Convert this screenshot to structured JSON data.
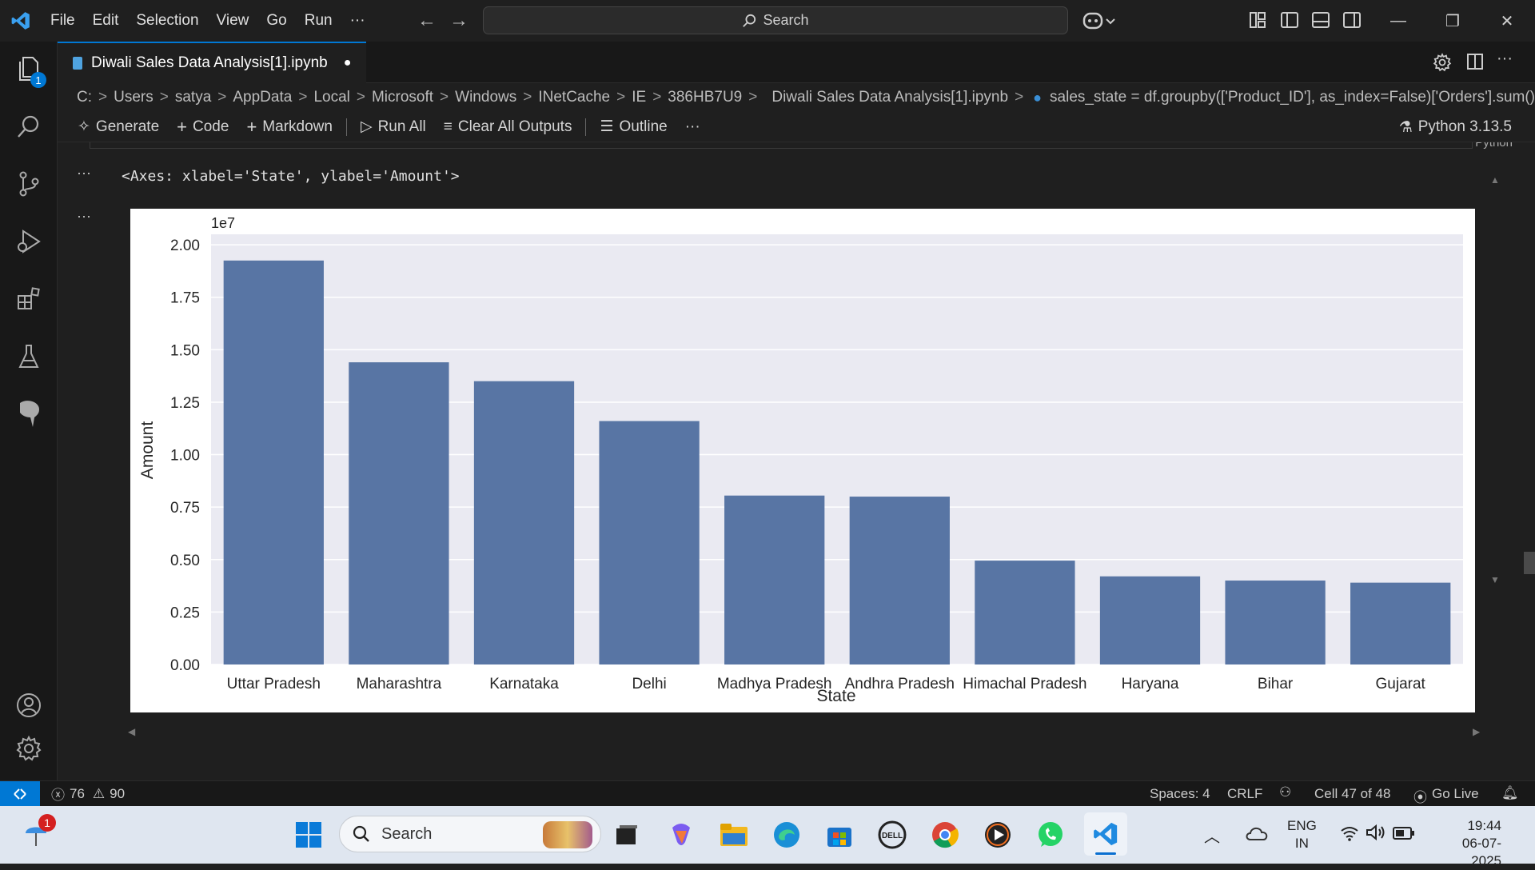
{
  "menu": [
    "File",
    "Edit",
    "Selection",
    "View",
    "Go",
    "Run",
    "···"
  ],
  "search": {
    "label": "Search"
  },
  "tab": {
    "title": "Diwali Sales Data Analysis[1].ipynb"
  },
  "explorer_badge": "1",
  "breadcrumb": [
    "C:",
    "Users",
    "satya",
    "AppData",
    "Local",
    "Microsoft",
    "Windows",
    "INetCache",
    "IE",
    "386HB7U9",
    "Diwali Sales Data Analysis[1].ipynb",
    "sales_state = df.groupby(['Product_ID'], as_index=False)['Orders'].sum()."
  ],
  "toolbar": {
    "generate": "Generate",
    "code": "Code",
    "markdown": "Markdown",
    "run_all": "Run All",
    "clear_outputs": "Clear All Outputs",
    "outline": "Outline",
    "more": "···",
    "kernel": "Python 3.13.5"
  },
  "cell": {
    "partial_label": "Python",
    "output_text": "<Axes: xlabel='State', ylabel='Amount'>",
    "ellipsis": "···"
  },
  "chart_data": {
    "type": "bar",
    "categories": [
      "Uttar Pradesh",
      "Maharashtra",
      "Karnataka",
      "Delhi",
      "Madhya Pradesh",
      "Andhra Pradesh",
      "Himachal Pradesh",
      "Haryana",
      "Bihar",
      "Gujarat"
    ],
    "values": [
      19.25,
      14.4,
      13.5,
      11.6,
      8.05,
      8.0,
      4.95,
      4.2,
      4.0,
      3.9
    ],
    "multiplier": "1e7",
    "xlabel": "State",
    "ylabel": "Amount",
    "yticks": [
      "0.00",
      "0.25",
      "0.50",
      "0.75",
      "1.00",
      "1.25",
      "1.50",
      "1.75",
      "2.00"
    ],
    "ylim": [
      0,
      20.5
    ],
    "bar_color": "#5875a4",
    "background": "#eaeaf2",
    "grid": true
  },
  "status": {
    "errors": "76",
    "warnings": "90",
    "spaces": "Spaces: 4",
    "eol": "CRLF",
    "cell": "Cell 47 of 48",
    "golive": "Go Live"
  },
  "taskbar": {
    "search": "Search",
    "lang1": "ENG",
    "lang2": "IN",
    "time": "19:44",
    "date": "06-07-2025",
    "notif_badge": "1"
  },
  "colors": {
    "accent": "#0078d4",
    "bg": "#1f1f1f",
    "sidebar": "#181818"
  }
}
